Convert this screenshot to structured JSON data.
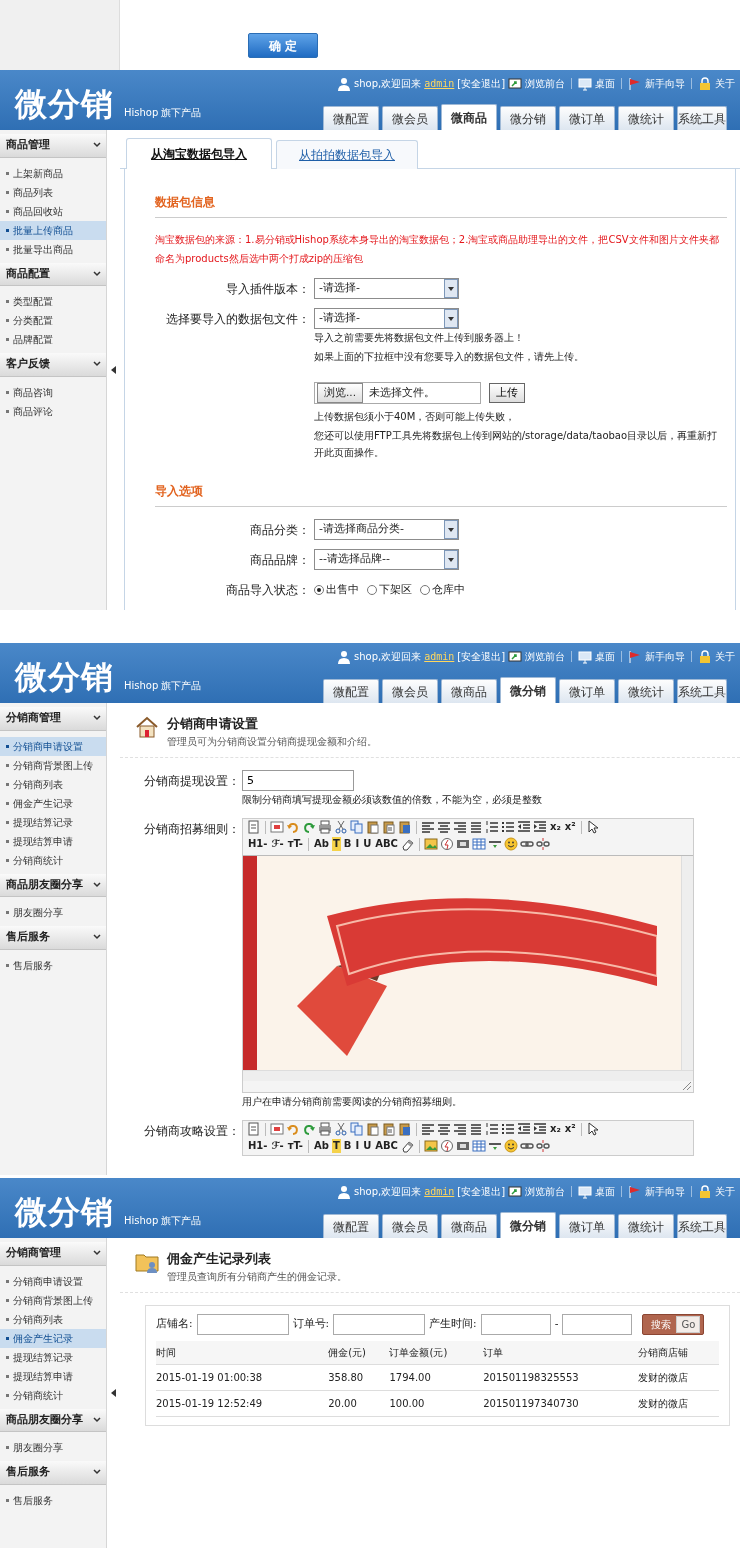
{
  "top_strip": {
    "confirm_button": "确 定"
  },
  "screens": [
    {
      "kind": "import",
      "collapse_handle": true,
      "header": {
        "logo": "微分销",
        "tagline": "Hishop 旗下产品",
        "greeting": "shop,欢迎回来",
        "user": "admin",
        "logout": "[安全退出]",
        "links": [
          "浏览前台",
          "桌面",
          "新手向导",
          "关于"
        ]
      },
      "tabs": [
        {
          "label": "微配置",
          "selected": false
        },
        {
          "label": "微会员",
          "selected": false
        },
        {
          "label": "微商品",
          "selected": true
        },
        {
          "label": "微分销",
          "selected": false
        },
        {
          "label": "微订单",
          "selected": false
        },
        {
          "label": "微统计",
          "selected": false
        },
        {
          "label": "系统工具",
          "selected": false
        }
      ],
      "sidebar": [
        {
          "title": "商品管理",
          "items": [
            {
              "label": "上架新商品",
              "selected": false
            },
            {
              "label": "商品列表",
              "selected": false
            },
            {
              "label": "商品回收站",
              "selected": false
            },
            {
              "label": "批量上传商品",
              "selected": true
            },
            {
              "label": "批量导出商品",
              "selected": false
            }
          ]
        },
        {
          "title": "商品配置",
          "items": [
            {
              "label": "类型配置",
              "selected": false
            },
            {
              "label": "分类配置",
              "selected": false
            },
            {
              "label": "品牌配置",
              "selected": false
            }
          ]
        },
        {
          "title": "客户反馈",
          "items": [
            {
              "label": "商品咨询",
              "selected": false
            },
            {
              "label": "商品评论",
              "selected": false
            }
          ]
        }
      ],
      "content": {
        "subtabs": [
          {
            "label": "从淘宝数据包导入",
            "selected": true
          },
          {
            "label": "从拍拍数据包导入",
            "selected": false
          }
        ],
        "sections": [
          {
            "title": "数据包信息",
            "note": "淘宝数据包的来源：1.易分销或Hishop系统本身导出的淘宝数据包；2.淘宝或商品助理导出的文件，把CSV文件和图片文件夹都命名为products然后选中两个打成zip的压缩包",
            "rows": [
              {
                "kind": "select",
                "label": "导入插件版本：",
                "value": "-请选择-"
              },
              {
                "kind": "select",
                "label": "选择要导入的数据包文件：",
                "value": "-请选择-",
                "hints": [
                  "导入之前需要先将数据包文件上传到服务器上！",
                  "如果上面的下拉框中没有您要导入的数据包文件，请先上传。"
                ]
              },
              {
                "kind": "file",
                "browse": "浏览...",
                "status": "未选择文件。",
                "upload": "上传",
                "hints": [
                  "上传数据包须小于40M，否则可能上传失败，",
                  "您还可以使用FTP工具先将数据包上传到网站的/storage/data/taobao目录以后，再重新打开此页面操作。"
                ]
              }
            ]
          },
          {
            "title": "导入选项",
            "rows": [
              {
                "kind": "select",
                "label": "商品分类：",
                "value": "-请选择商品分类-"
              },
              {
                "kind": "select",
                "label": "商品品牌：",
                "value": "--请选择品牌--"
              },
              {
                "kind": "radio",
                "label": "商品导入状态：",
                "options": [
                  {
                    "label": "出售中",
                    "selected": true
                  },
                  {
                    "label": "下架区",
                    "selected": false
                  },
                  {
                    "label": "仓库中",
                    "selected": false
                  }
                ]
              }
            ]
          }
        ]
      }
    },
    {
      "kind": "settings",
      "collapse_handle": false,
      "header": {
        "logo": "微分销",
        "tagline": "Hishop 旗下产品",
        "greeting": "shop,欢迎回来",
        "user": "admin",
        "logout": "[安全退出]",
        "links": [
          "浏览前台",
          "桌面",
          "新手向导",
          "关于"
        ]
      },
      "tabs": [
        {
          "label": "微配置",
          "selected": false
        },
        {
          "label": "微会员",
          "selected": false
        },
        {
          "label": "微商品",
          "selected": false
        },
        {
          "label": "微分销",
          "selected": true
        },
        {
          "label": "微订单",
          "selected": false
        },
        {
          "label": "微统计",
          "selected": false
        },
        {
          "label": "系统工具",
          "selected": false
        }
      ],
      "sidebar": [
        {
          "title": "分销商管理",
          "items": [
            {
              "label": "分销商申请设置",
              "selected": true
            },
            {
              "label": "分销商背景图上传",
              "selected": false
            },
            {
              "label": "分销商列表",
              "selected": false
            },
            {
              "label": "佣金产生记录",
              "selected": false
            },
            {
              "label": "提现结算记录",
              "selected": false
            },
            {
              "label": "提现结算申请",
              "selected": false
            },
            {
              "label": "分销商统计",
              "selected": false
            }
          ]
        },
        {
          "title": "商品朋友圈分享",
          "items": [
            {
              "label": "朋友圈分享",
              "selected": false
            }
          ]
        },
        {
          "title": "售后服务",
          "items": [
            {
              "label": "售后服务",
              "selected": false
            }
          ]
        }
      ],
      "content": {
        "title": "分销商申请设置",
        "description": "管理员可为分销商设置分销商提现金额和介绍。",
        "rows": [
          {
            "kind": "text",
            "label": "分销商提现设置：",
            "value": "5",
            "hint": "限制分销商填写提现金额必须该数值的倍数，不能为空，必须是整数"
          },
          {
            "kind": "editor",
            "label": "分销商招募细则：",
            "has_image": true,
            "hint": "用户在申请分销商前需要阅读的分销商招募细则。",
            "toolbar": [
              [
                {
                  "kind": "icon"
                },
                {
                  "kind": "separator"
                },
                {
                  "kind": "icon"
                },
                {
                  "kind": "icon"
                },
                {
                  "kind": "icon"
                },
                {
                  "kind": "icon"
                },
                {
                  "kind": "icon"
                },
                {
                  "kind": "icon"
                },
                {
                  "kind": "icon"
                },
                {
                  "kind": "icon"
                },
                {
                  "kind": "icon"
                },
                {
                  "kind": "separator"
                },
                {
                  "kind": "icon"
                },
                {
                  "kind": "icon"
                },
                {
                  "kind": "icon"
                },
                {
                  "kind": "icon"
                },
                {
                  "kind": "icon"
                },
                {
                  "kind": "icon"
                },
                {
                  "kind": "icon"
                },
                {
                  "kind": "icon"
                },
                {
                  "kind": "text",
                  "label": "x₂"
                },
                {
                  "kind": "text",
                  "label": "x²"
                },
                {
                  "kind": "separator"
                },
                {
                  "kind": "icon"
                }
              ],
              [
                {
                  "kind": "text",
                  "label": "H1-"
                },
                {
                  "kind": "text",
                  "label": "ℱ-"
                },
                {
                  "kind": "text",
                  "label": "ᴛT-"
                },
                {
                  "kind": "separator"
                },
                {
                  "kind": "text",
                  "label": "Ab"
                },
                {
                  "kind": "highlight",
                  "label": "T"
                },
                {
                  "kind": "text",
                  "label": "B"
                },
                {
                  "kind": "text",
                  "label": "I"
                },
                {
                  "kind": "text",
                  "label": "U"
                },
                {
                  "kind": "text",
                  "label": "ABC"
                },
                {
                  "kind": "icon"
                },
                {
                  "kind": "separator"
                },
                {
                  "kind": "icon"
                },
                {
                  "kind": "icon"
                },
                {
                  "kind": "icon"
                },
                {
                  "kind": "icon"
                },
                {
                  "kind": "icon"
                },
                {
                  "kind": "icon"
                },
                {
                  "kind": "icon"
                },
                {
                  "kind": "icon"
                }
              ]
            ]
          },
          {
            "kind": "editor",
            "label": "分销商攻略设置：",
            "has_image": false,
            "toolbar": [
              [
                {
                  "kind": "icon"
                },
                {
                  "kind": "separator"
                },
                {
                  "kind": "icon"
                },
                {
                  "kind": "icon"
                },
                {
                  "kind": "icon"
                },
                {
                  "kind": "icon"
                },
                {
                  "kind": "icon"
                },
                {
                  "kind": "icon"
                },
                {
                  "kind": "icon"
                },
                {
                  "kind": "icon"
                },
                {
                  "kind": "icon"
                },
                {
                  "kind": "separator"
                },
                {
                  "kind": "icon"
                },
                {
                  "kind": "icon"
                },
                {
                  "kind": "icon"
                },
                {
                  "kind": "icon"
                },
                {
                  "kind": "icon"
                },
                {
                  "kind": "icon"
                },
                {
                  "kind": "icon"
                },
                {
                  "kind": "icon"
                },
                {
                  "kind": "text",
                  "label": "x₂"
                },
                {
                  "kind": "text",
                  "label": "x²"
                },
                {
                  "kind": "separator"
                },
                {
                  "kind": "icon"
                }
              ],
              [
                {
                  "kind": "text",
                  "label": "H1-"
                },
                {
                  "kind": "text",
                  "label": "ℱ-"
                },
                {
                  "kind": "text",
                  "label": "ᴛT-"
                },
                {
                  "kind": "separator"
                },
                {
                  "kind": "text",
                  "label": "Ab"
                },
                {
                  "kind": "highlight",
                  "label": "T"
                },
                {
                  "kind": "text",
                  "label": "B"
                },
                {
                  "kind": "text",
                  "label": "I"
                },
                {
                  "kind": "text",
                  "label": "U"
                },
                {
                  "kind": "text",
                  "label": "ABC"
                },
                {
                  "kind": "icon"
                },
                {
                  "kind": "separator"
                },
                {
                  "kind": "icon"
                },
                {
                  "kind": "icon"
                },
                {
                  "kind": "icon"
                },
                {
                  "kind": "icon"
                },
                {
                  "kind": "icon"
                },
                {
                  "kind": "icon"
                },
                {
                  "kind": "icon"
                },
                {
                  "kind": "icon"
                }
              ]
            ]
          }
        ]
      }
    },
    {
      "kind": "records",
      "collapse_handle": true,
      "header": {
        "logo": "微分销",
        "tagline": "Hishop 旗下产品",
        "greeting": "shop,欢迎回来",
        "user": "admin",
        "logout": "[安全退出]",
        "links": [
          "浏览前台",
          "桌面",
          "新手向导",
          "关于"
        ]
      },
      "tabs": [
        {
          "label": "微配置",
          "selected": false
        },
        {
          "label": "微会员",
          "selected": false
        },
        {
          "label": "微商品",
          "selected": false
        },
        {
          "label": "微分销",
          "selected": true
        },
        {
          "label": "微订单",
          "selected": false
        },
        {
          "label": "微统计",
          "selected": false
        },
        {
          "label": "系统工具",
          "selected": false
        }
      ],
      "sidebar": [
        {
          "title": "分销商管理",
          "items": [
            {
              "label": "分销商申请设置",
              "selected": false
            },
            {
              "label": "分销商背景图上传",
              "selected": false
            },
            {
              "label": "分销商列表",
              "selected": false
            },
            {
              "label": "佣金产生记录",
              "selected": true
            },
            {
              "label": "提现结算记录",
              "selected": false
            },
            {
              "label": "提现结算申请",
              "selected": false
            },
            {
              "label": "分销商统计",
              "selected": false
            }
          ]
        },
        {
          "title": "商品朋友圈分享",
          "items": [
            {
              "label": "朋友圈分享",
              "selected": false
            }
          ]
        },
        {
          "title": "售后服务",
          "items": [
            {
              "label": "售后服务",
              "selected": false
            }
          ]
        }
      ],
      "content": {
        "title": "佣金产生记录列表",
        "description": "管理员查询所有分销商产生的佣金记录。",
        "filters": [
          {
            "label": "店铺名:"
          },
          {
            "label": "订单号:"
          },
          {
            "label": "产生时间:",
            "separator": "-"
          }
        ],
        "search_button": "搜索",
        "go": "Go",
        "table": {
          "columns": [
            "时间",
            "佣金(元)",
            "订单金额(元)",
            "订单",
            "分销商店铺"
          ],
          "rows": [
            [
              "2015-01-19 01:00:38",
              "358.80",
              "1794.00",
              "201501198325553",
              "发财的微店"
            ],
            [
              "2015-01-19 12:52:49",
              "20.00",
              "100.00",
              "201501197340730",
              "发财的微店"
            ]
          ]
        }
      }
    }
  ]
}
